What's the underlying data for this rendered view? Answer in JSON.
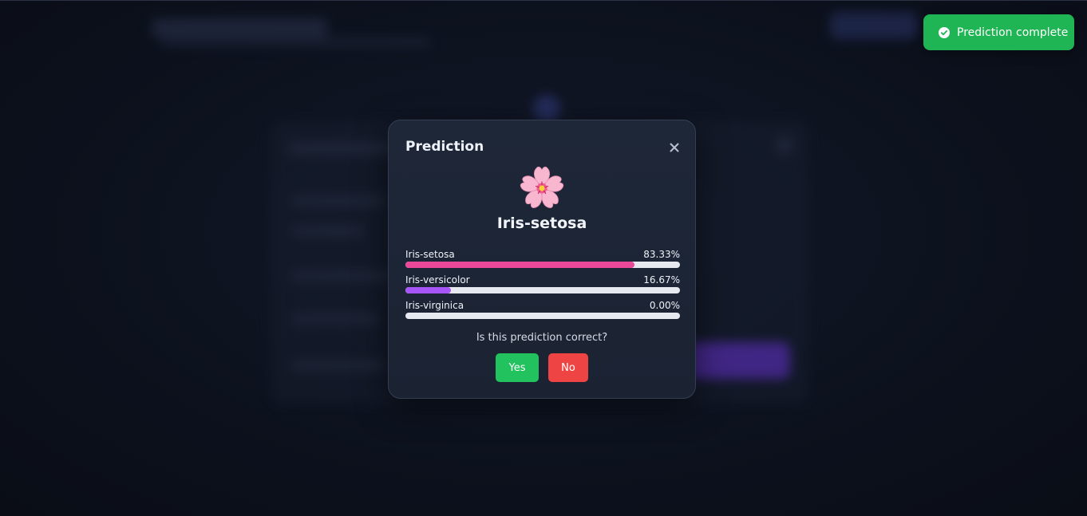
{
  "toast": {
    "message": "Prediction complete",
    "icon": "check-circle-icon",
    "color": "#1fb454"
  },
  "modal": {
    "title": "Prediction",
    "close_icon": "close-icon",
    "result_icon": "cherry-blossom-icon",
    "result_label": "Iris-setosa",
    "probabilities": [
      {
        "name": "Iris-setosa",
        "value_label": "83.33%",
        "value": 83.33,
        "color": "#ec4899"
      },
      {
        "name": "Iris-versicolor",
        "value_label": "16.67%",
        "value": 16.67,
        "color": "#a855f7"
      },
      {
        "name": "Iris-virginica",
        "value_label": "0.00%",
        "value": 0.0,
        "color": "#a855f7"
      }
    ],
    "feedback_question": "Is this prediction correct?",
    "yes_label": "Yes",
    "no_label": "No",
    "yes_color": "#22c35e",
    "no_color": "#ef4444"
  }
}
